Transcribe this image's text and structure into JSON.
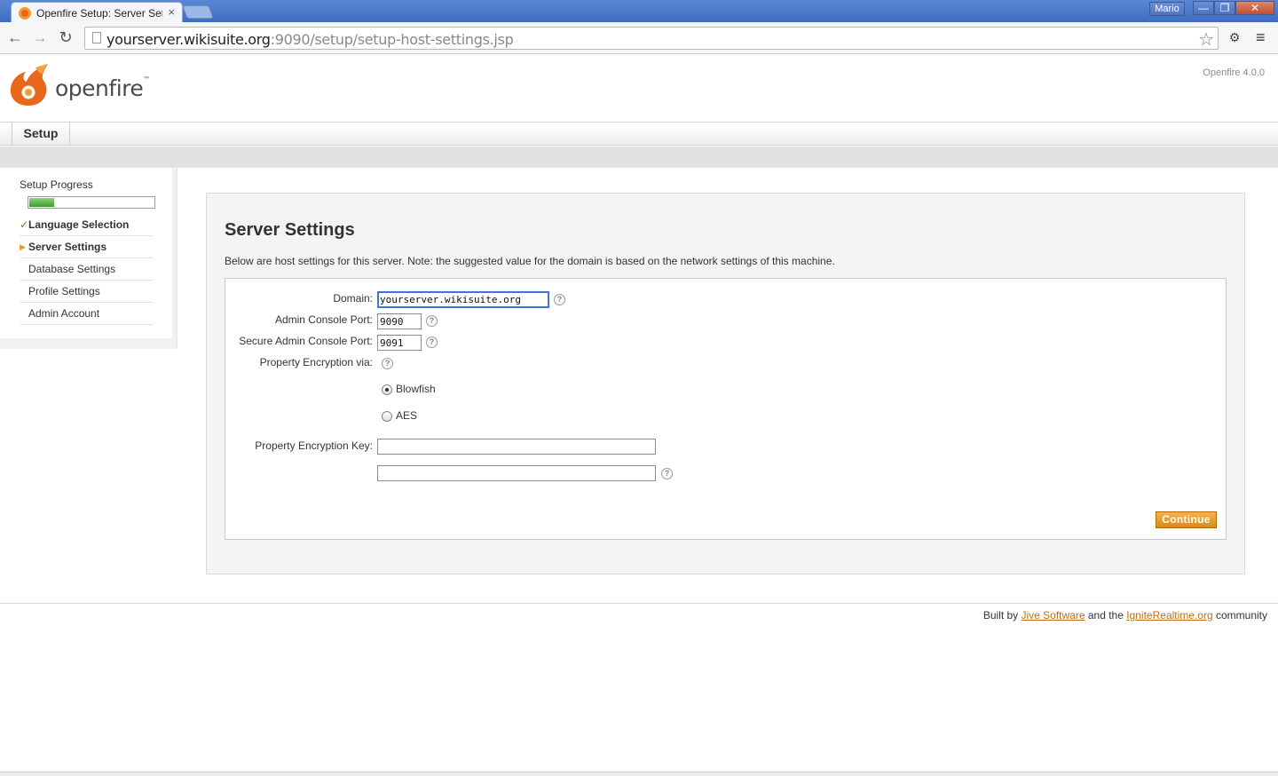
{
  "browser": {
    "tab_title": "Openfire Setup: Server Settings",
    "tab_close": "×",
    "user_button": "Mario",
    "win_min": "—",
    "win_max": "❐",
    "win_close": "✕",
    "url_host": "yourserver.wikisuite.org",
    "url_rest": ":9090/setup/setup-host-settings.jsp",
    "icons": {
      "back": "back-arrow-icon",
      "forward": "forward-arrow-icon",
      "reload": "reload-icon",
      "page": "page-icon",
      "star": "bookmark-star-icon",
      "extension": "extension-icon",
      "menu": "menu-icon"
    }
  },
  "header": {
    "logo_text": "openfire",
    "logo_tm": "™",
    "version": "Openfire 4.0.0",
    "nav_tab": "Setup"
  },
  "sidebar": {
    "progress_label": "Setup Progress",
    "progress_fraction": 0.2,
    "steps": [
      {
        "label": "Language Selection",
        "state": "done"
      },
      {
        "label": "Server Settings",
        "state": "current"
      },
      {
        "label": "Database Settings",
        "state": "pending"
      },
      {
        "label": "Profile Settings",
        "state": "pending"
      },
      {
        "label": "Admin Account",
        "state": "pending"
      }
    ]
  },
  "main": {
    "title": "Server Settings",
    "intro": "Below are host settings for this server. Note: the suggested value for the domain is based on the network settings of this machine.",
    "form": {
      "domain_label": "Domain:",
      "domain_value": "yourserver.wikisuite.org",
      "admin_port_label": "Admin Console Port:",
      "admin_port_value": "9090",
      "secure_port_label": "Secure Admin Console Port:",
      "secure_port_value": "9091",
      "encryption_via_label": "Property Encryption via:",
      "encryption_options": [
        "Blowfish",
        "AES"
      ],
      "encryption_selected": "Blowfish",
      "encryption_key_label": "Property Encryption Key:",
      "encryption_key_value": "",
      "encryption_key_confirm_value": "",
      "help_glyph": "?",
      "continue_label": "Continue"
    }
  },
  "footer": {
    "prefix": "Built by ",
    "link1": "Jive Software",
    "middle": " and the ",
    "link2": "IgniteRealtime.org",
    "suffix": " community"
  },
  "colors": {
    "accent_orange": "#d88a17",
    "link_color": "#c06e10",
    "progress_green": "#3c9b2c",
    "titlebar_blue": "#3f6cc0"
  }
}
